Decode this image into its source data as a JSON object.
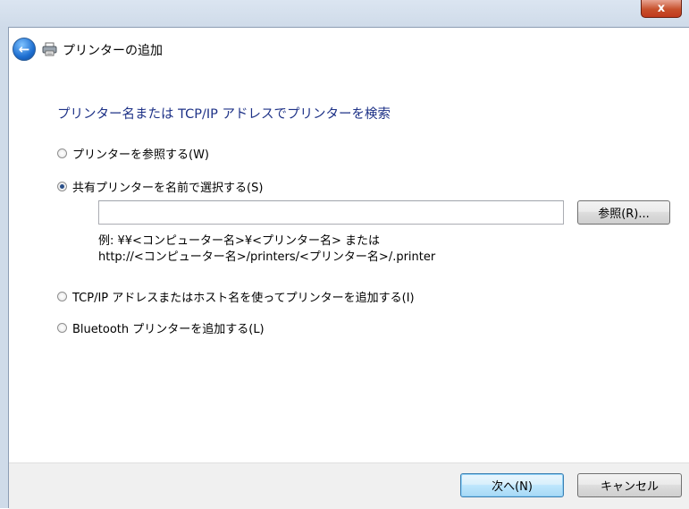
{
  "window": {
    "title": "プリンターの追加",
    "close_glyph": "x"
  },
  "icons": {
    "back": "back-arrow-icon",
    "printer": "printer-icon",
    "close": "close-icon"
  },
  "main": {
    "heading": "プリンター名または TCP/IP アドレスでプリンターを検索",
    "options": [
      {
        "label": "プリンターを参照する(W)",
        "checked": false
      },
      {
        "label": "共有プリンターを名前で選択する(S)",
        "checked": true
      },
      {
        "label": "TCP/IP アドレスまたはホスト名を使ってプリンターを追加する(I)",
        "checked": false
      },
      {
        "label": "Bluetooth プリンターを追加する(L)",
        "checked": false
      }
    ],
    "printer_name_input": {
      "value": "",
      "placeholder": ""
    },
    "browse_button": "参照(R)...",
    "example_line1": "例: ¥¥<コンピューター名>¥<プリンター名> または",
    "example_line2": "http://<コンピューター名>/printers/<プリンター名>/.printer"
  },
  "footer": {
    "next_button": "次へ(N)",
    "cancel_button": "キャンセル"
  },
  "colors": {
    "heading": "#1e3287",
    "footer_bg": "#f0f0f0",
    "close_button": "#c7502c"
  }
}
